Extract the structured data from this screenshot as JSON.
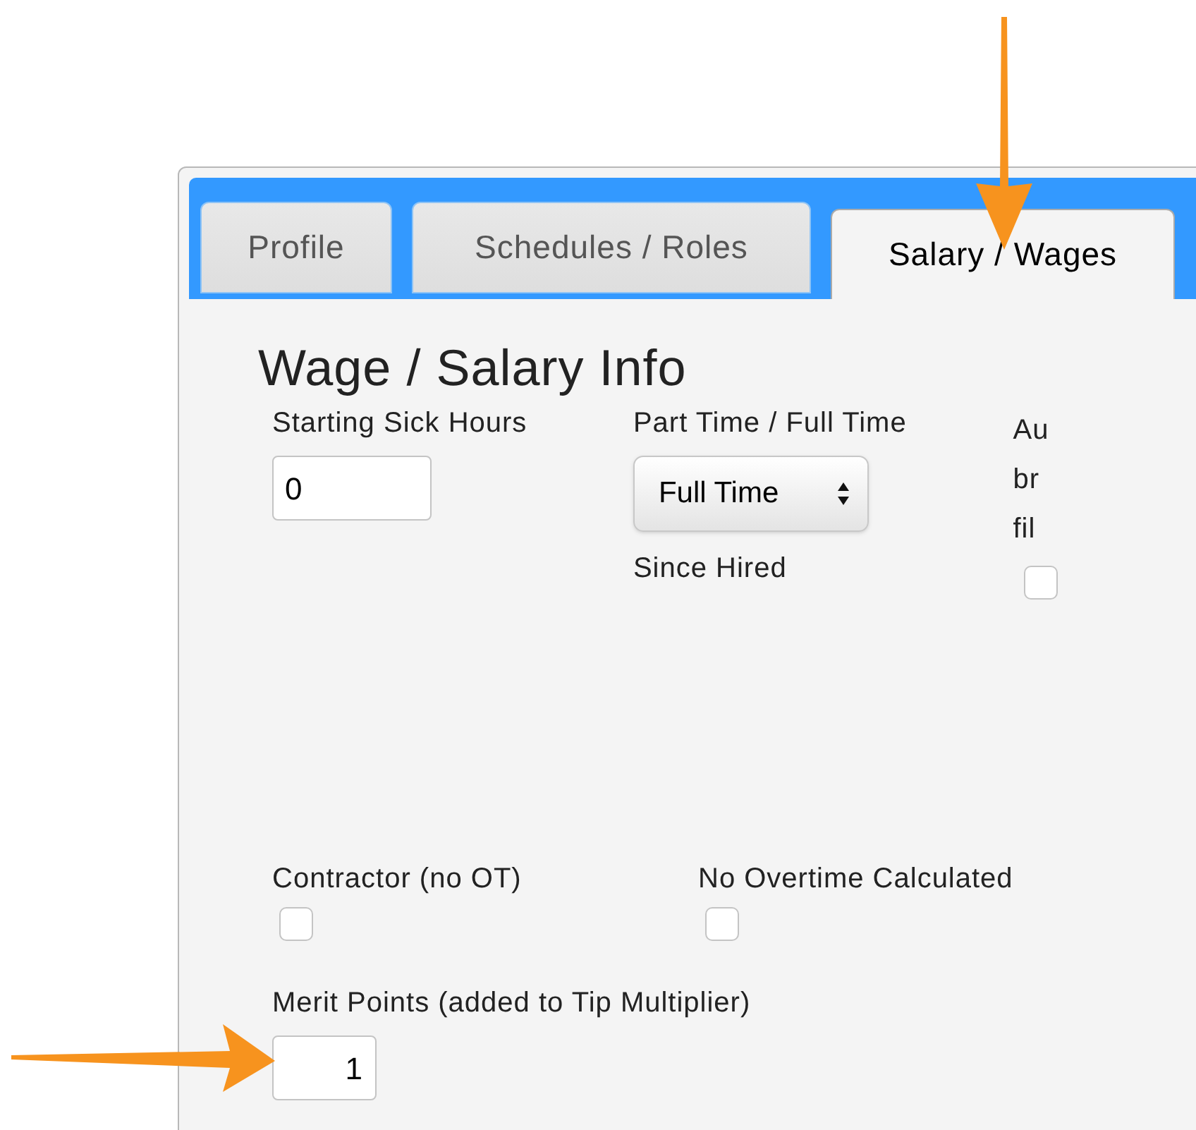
{
  "tabs": [
    {
      "label": "Profile",
      "selected": false
    },
    {
      "label": "Schedules / Roles",
      "selected": false
    },
    {
      "label": "Salary / Wages",
      "selected": true
    }
  ],
  "heading": "Wage / Salary Info",
  "top_fields": [
    {
      "kind": "text",
      "label": "Starting Sick Hours",
      "value": "0"
    },
    {
      "kind": "select",
      "label": "Part Time / Full Time",
      "value": "Full Time",
      "note": "Since Hired"
    },
    {
      "kind": "checkbox",
      "label_lines": [
        "Au",
        "br",
        "fil"
      ],
      "checked": false
    }
  ],
  "bottom_fields": [
    {
      "kind": "checkbox",
      "label": "Contractor (no OT)",
      "checked": false
    },
    {
      "kind": "checkbox",
      "label": "No Overtime Calculated",
      "checked": false
    }
  ],
  "merit": {
    "label": "Merit Points (added to Tip Multiplier)",
    "value": "1"
  }
}
